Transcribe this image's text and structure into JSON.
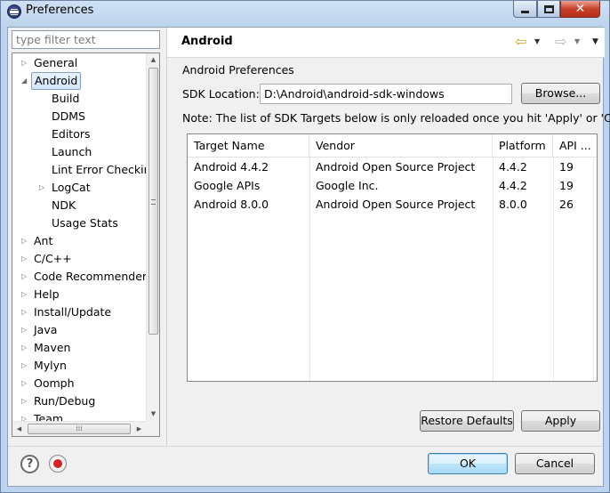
{
  "window": {
    "title": "Preferences"
  },
  "filter": {
    "placeholder": "type filter text"
  },
  "tree": {
    "items": [
      {
        "label": "General",
        "expandable": true,
        "expanded": false,
        "level": 0
      },
      {
        "label": "Android",
        "expandable": true,
        "expanded": true,
        "level": 0,
        "selected": true
      },
      {
        "label": "Build",
        "expandable": false,
        "level": 1
      },
      {
        "label": "DDMS",
        "expandable": false,
        "level": 1
      },
      {
        "label": "Editors",
        "expandable": false,
        "level": 1
      },
      {
        "label": "Launch",
        "expandable": false,
        "level": 1
      },
      {
        "label": "Lint Error Checking",
        "expandable": false,
        "level": 1
      },
      {
        "label": "LogCat",
        "expandable": true,
        "expanded": false,
        "level": 1
      },
      {
        "label": "NDK",
        "expandable": false,
        "level": 1
      },
      {
        "label": "Usage Stats",
        "expandable": false,
        "level": 1
      },
      {
        "label": "Ant",
        "expandable": true,
        "level": 0
      },
      {
        "label": "C/C++",
        "expandable": true,
        "level": 0
      },
      {
        "label": "Code Recommenders",
        "expandable": true,
        "level": 0
      },
      {
        "label": "Help",
        "expandable": true,
        "level": 0
      },
      {
        "label": "Install/Update",
        "expandable": true,
        "level": 0
      },
      {
        "label": "Java",
        "expandable": true,
        "level": 0
      },
      {
        "label": "Maven",
        "expandable": true,
        "level": 0
      },
      {
        "label": "Mylyn",
        "expandable": true,
        "level": 0
      },
      {
        "label": "Oomph",
        "expandable": true,
        "level": 0
      },
      {
        "label": "Run/Debug",
        "expandable": true,
        "level": 0
      },
      {
        "label": "Team",
        "expandable": true,
        "level": 0
      }
    ]
  },
  "page": {
    "title": "Android",
    "preferences_label": "Android Preferences",
    "sdk_location_label": "SDK Location:",
    "sdk_location_value": "D:\\Android\\android-sdk-windows",
    "browse_label": "Browse...",
    "note": "Note: The list of SDK Targets below is only reloaded once you hit 'Apply' or 'OK'."
  },
  "targets_table": {
    "columns": [
      "Target Name",
      "Vendor",
      "Platform",
      "API ..."
    ],
    "rows": [
      [
        "Android 4.4.2",
        "Android Open Source Project",
        "4.4.2",
        "19"
      ],
      [
        "Google APIs",
        "Google Inc.",
        "4.4.2",
        "19"
      ],
      [
        "Android 8.0.0",
        "Android Open Source Project",
        "8.0.0",
        "26"
      ]
    ]
  },
  "buttons": {
    "restore_defaults": "Restore Defaults",
    "apply": "Apply",
    "ok": "OK",
    "cancel": "Cancel"
  },
  "icons": {
    "nav_back": "back-arrow-icon",
    "nav_forward": "forward-arrow-icon",
    "help": "help-icon",
    "record": "record-macro-icon"
  },
  "colors": {
    "titlebar": "#bcd3ee",
    "close_button": "#c8412b",
    "selection": "#d3e5fb",
    "record": "#d82020"
  }
}
